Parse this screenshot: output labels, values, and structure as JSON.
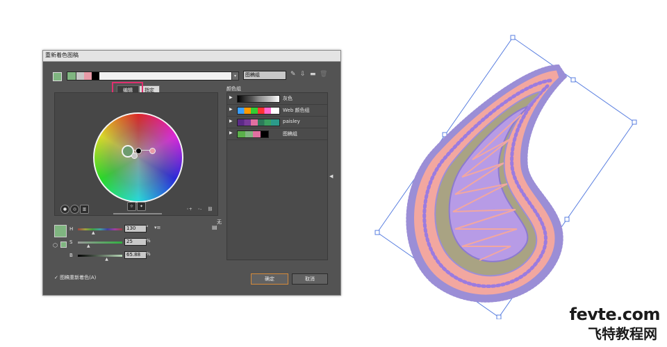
{
  "dialog": {
    "title": "重新着色图稿",
    "group_name": "图稿组",
    "tabs": [
      "编辑",
      "指定"
    ],
    "color_groups_header": "颜色组",
    "color_groups": [
      {
        "name": "灰色"
      },
      {
        "name": "Web 颜色组"
      },
      {
        "name": "paisley"
      },
      {
        "name": "图稿组"
      }
    ],
    "sliders": [
      {
        "label": "H",
        "value": "130",
        "unit": "°",
        "fraction": 0.36
      },
      {
        "label": "S",
        "value": "25",
        "unit": "%",
        "fraction": 0.25
      },
      {
        "label": "B",
        "value": "65.88",
        "unit": "%",
        "fraction": 0.66
      }
    ],
    "none_label": "无",
    "recolor_label": "图稿重新着色(A)",
    "ok_label": "确定",
    "cancel_label": "取消",
    "colors": {
      "swatch_green": "#7fb580",
      "swatch_pink": "#e89aa7",
      "swatch_black": "#000000",
      "highlight": "#e0306f"
    }
  },
  "artwork": {
    "outline_color": "#9b8ed6",
    "fill_pink": "#f2a7a0",
    "fill_olive": "#a9a383",
    "fill_lavender": "#b79be6",
    "selection_color": "#5a7fe0"
  },
  "watermark": {
    "line1": "fevte.com",
    "line2": "飞特教程网"
  }
}
